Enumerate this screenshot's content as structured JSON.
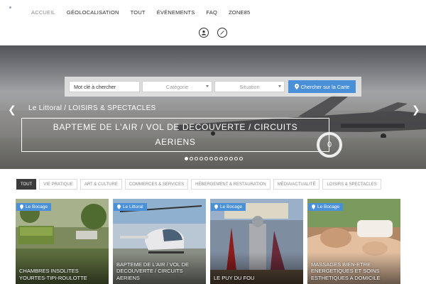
{
  "nav": {
    "items": [
      {
        "label": "ACCUEIL",
        "active": true
      },
      {
        "label": "GÉOLOCALISATION",
        "active": false
      },
      {
        "label": "TOUT",
        "active": false
      },
      {
        "label": "ÉVÉNEMENTS",
        "active": false
      },
      {
        "label": "FAQ",
        "active": false
      },
      {
        "label": "ZONE85",
        "active": false
      }
    ],
    "icons": [
      "user-icon",
      "compass-icon"
    ]
  },
  "search": {
    "keyword_placeholder": "Mot clé à chercher",
    "category_label": "Catégorie",
    "situation_label": "Situation",
    "button_label": "Chercher sur la Carte",
    "button_color": "#4a90d9"
  },
  "hero": {
    "category": "Le Littoral / LOISIRS & SPECTACLES",
    "title": "BAPTEME DE L'AIR / VOL DE DECOUVERTE / CIRCUITS AERIENS",
    "ring_text": "0",
    "slide_count": 12,
    "active_slide": 0
  },
  "filters": [
    {
      "label": "TOUT",
      "active": true
    },
    {
      "label": "VIE PRATIQUE",
      "active": false
    },
    {
      "label": "ART & CULTURE",
      "active": false
    },
    {
      "label": "COMMERCES & SERVICES",
      "active": false
    },
    {
      "label": "HÉBERGEMENT & RESTAURATION",
      "active": false
    },
    {
      "label": "MÉDIA/ACTUALITÉ",
      "active": false
    },
    {
      "label": "LOISIRS & SPECTACLES",
      "active": false
    }
  ],
  "cards": [
    {
      "badge": "Le Bocage",
      "title": "CHAMBRES INSOLITES YOURTES-TIPI-ROULOTTE"
    },
    {
      "badge": "Le Littoral",
      "title": "BAPTEME DE L'AIR / VOL DE DECOUVERTE / CIRCUITS AERIENS"
    },
    {
      "badge": "Le Bocage",
      "title": "LE PUY DU FOU"
    },
    {
      "badge": "Le Bocage",
      "title": "MASSAGES BIEN-ETRE ENERGETIQUES ET SOINS ESTHETIQUES A DOMICILE"
    }
  ],
  "colors": {
    "accent": "#4a90d9",
    "filter_active": "#3b3b3b"
  }
}
